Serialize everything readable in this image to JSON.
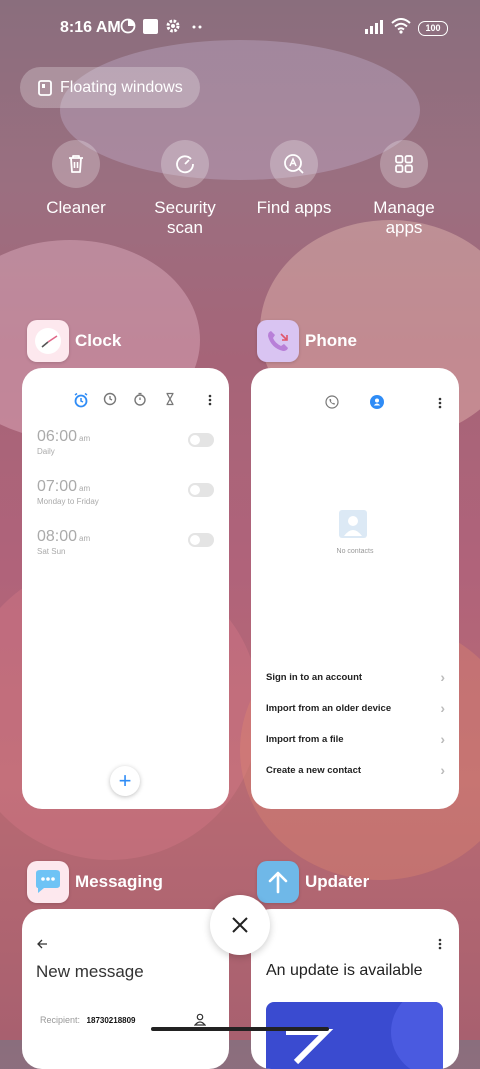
{
  "status_bar": {
    "time": "8:16 AM",
    "battery": "100"
  },
  "floating_windows": {
    "label": "Floating windows"
  },
  "quick_actions": [
    {
      "label": "Cleaner",
      "icon": "trash-icon"
    },
    {
      "label": "Security scan",
      "icon": "security-scan-icon"
    },
    {
      "label": "Find apps",
      "icon": "find-apps-icon"
    },
    {
      "label": "Manage apps",
      "icon": "grid-icon"
    }
  ],
  "recent_apps": {
    "clock": {
      "name": "Clock",
      "alarms": [
        {
          "time": "06:00",
          "ampm": "am",
          "repeat": "Daily"
        },
        {
          "time": "07:00",
          "ampm": "am",
          "repeat": "Monday to Friday"
        },
        {
          "time": "08:00",
          "ampm": "am",
          "repeat": "Sat Sun"
        }
      ],
      "add_symbol": "+"
    },
    "phone": {
      "name": "Phone",
      "empty_state": "No contacts",
      "options": [
        "Sign in to an account",
        "Import from an older device",
        "Import from a file",
        "Create a new contact"
      ]
    },
    "messaging": {
      "name": "Messaging",
      "title": "New message",
      "recipient_label": "Recipient:",
      "recipient_value": "18730218809"
    },
    "updater": {
      "name": "Updater",
      "headline": "An update is available"
    }
  },
  "colors": {
    "accent": "#2f8cf6",
    "updater_banner": "#3a4bd0",
    "phone_icon_bg": "#d9c4f2"
  }
}
